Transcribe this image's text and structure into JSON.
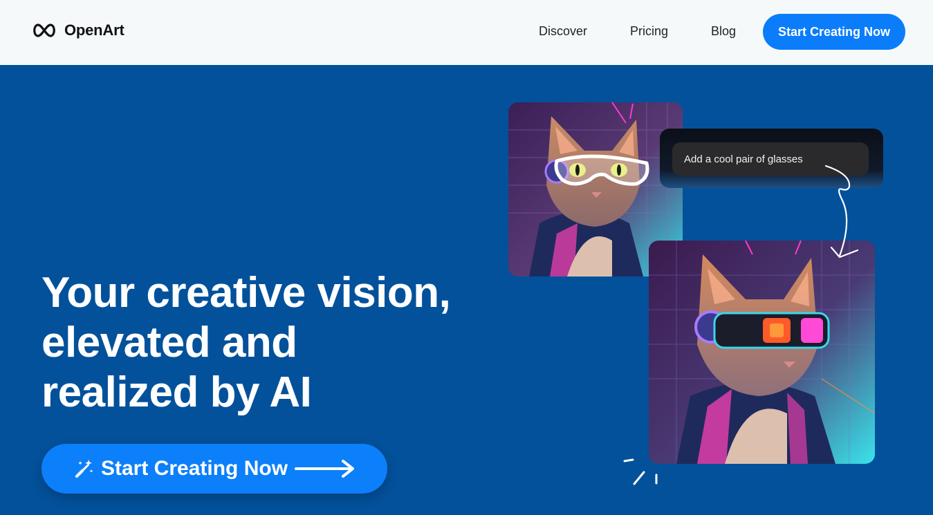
{
  "brand": {
    "name": "OpenArt",
    "logo_icon": "infinity-icon"
  },
  "nav": {
    "items": [
      {
        "label": "Discover"
      },
      {
        "label": "Pricing"
      },
      {
        "label": "Blog"
      }
    ],
    "cta_label": "Start Creating Now"
  },
  "hero": {
    "title_lines": [
      "Your creative vision,",
      "elevated and",
      "realized by AI"
    ],
    "cta_label": "Start Creating Now",
    "cta_icon": "magic-wand-icon",
    "cta_arrow_icon": "arrow-right-icon"
  },
  "demo": {
    "prompt_text": "Add a cool pair of glasses",
    "before_image": "cat-with-sketched-glasses",
    "after_image": "cat-with-cyber-goggles"
  },
  "colors": {
    "header_bg": "#f6f9f9",
    "hero_bg": "#03519b",
    "accent": "#0b7dfb"
  }
}
